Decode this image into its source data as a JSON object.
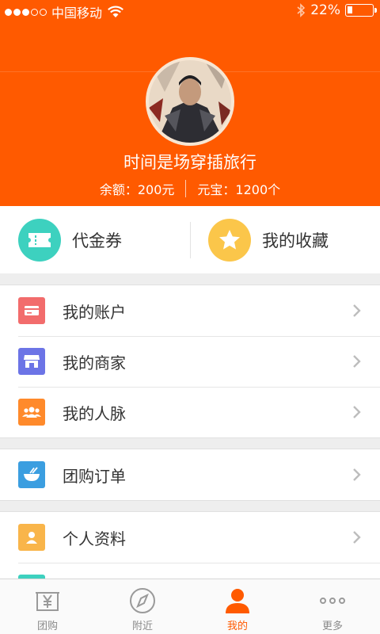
{
  "status_bar": {
    "carrier": "中国移动",
    "battery_pct": "22%",
    "battery_level": 0.22,
    "signal_bars": 3
  },
  "profile": {
    "username": "时间是场穿插旅行",
    "balance": "余额：200元",
    "coins": "元宝：1200个"
  },
  "quick_tiles": [
    {
      "label": "代金券",
      "icon": "ticket-icon",
      "color": "#3dd1bf"
    },
    {
      "label": "我的收藏",
      "icon": "star-icon",
      "color": "#fbc64a"
    }
  ],
  "menu": {
    "group1": [
      {
        "label": "我的账户",
        "icon": "card-icon",
        "color": "#f26c6c"
      },
      {
        "label": "我的商家",
        "icon": "store-icon",
        "color": "#6c74e6"
      },
      {
        "label": "我的人脉",
        "icon": "people-icon",
        "color": "#ff8a2b"
      }
    ],
    "group2": [
      {
        "label": "团购订单",
        "icon": "bowl-icon",
        "color": "#3b9ee0"
      }
    ],
    "group3": [
      {
        "label": "个人资料",
        "icon": "person-card-icon",
        "color": "#f9b54a"
      }
    ]
  },
  "tabbar": {
    "tabs": [
      {
        "label": "团购",
        "icon": "yen-icon"
      },
      {
        "label": "附近",
        "icon": "compass-icon"
      },
      {
        "label": "我的",
        "icon": "user-icon",
        "active": true
      },
      {
        "label": "更多",
        "icon": "more-dots-icon"
      }
    ],
    "active_color": "#ff5a00"
  },
  "colors": {
    "brand": "#ff5a00",
    "background": "#eeeeee"
  }
}
